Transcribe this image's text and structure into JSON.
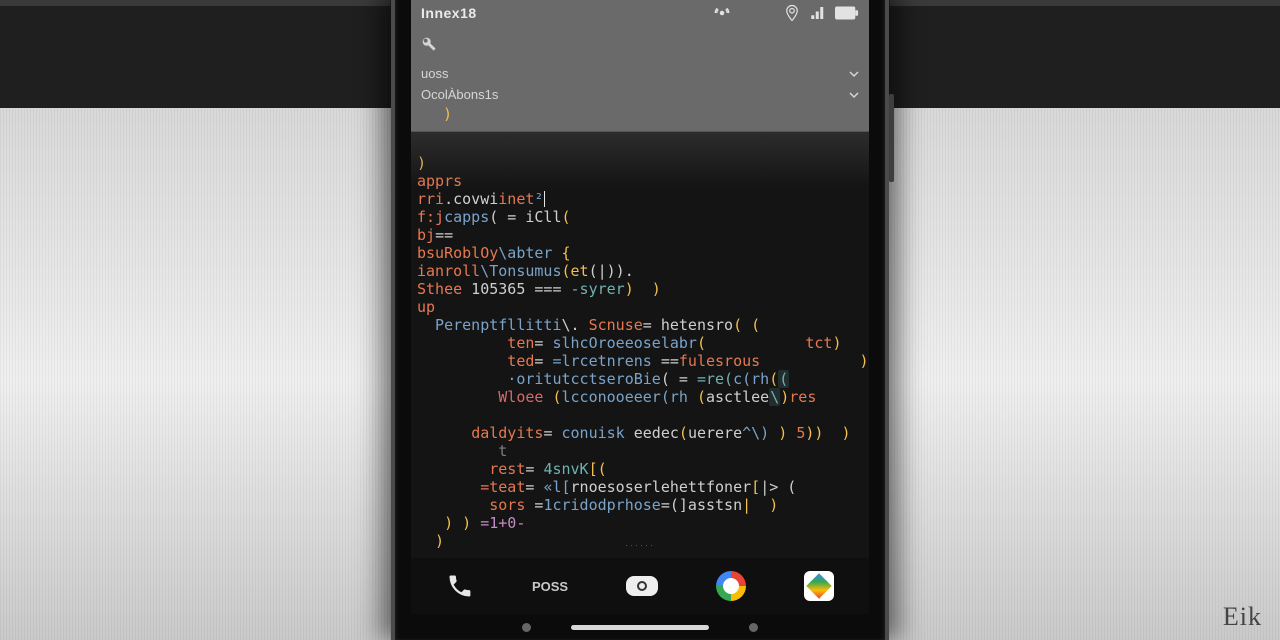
{
  "watermark": "Eik",
  "statusbar": {
    "carrier": "Innex18"
  },
  "notif": {
    "row1": "uoss",
    "row2": "OcolÀbons1s",
    "paren": ")"
  },
  "code": {
    "l1_paren": ")",
    "l2_apprs": "apprs",
    "l3_a": "rri",
    "l3_b": ".covwi",
    "l3_c": "inet",
    "l3_d": "²",
    "l3_caret": "|",
    "l4_a": "f:j",
    "l4_b": "capps",
    "l4_c": "( = ",
    "l4_d": "iCll",
    "l4_e": "(",
    "l5_a": "bj",
    "l5_b": "==",
    "l6_a": "bsuRoblOy",
    "l6_b": "\\abter",
    "l6_c": " {",
    "l7_a": "ianroll",
    "l7_b": "\\Tonsumus",
    "l7_c": "(et",
    "l7_d": "(|)).",
    "l8_a": "Sthee",
    "l8_b": " 105365 ",
    "l8_c": "=== ",
    "l8_d": "-syrer",
    "l8_e": ")  )",
    "l9_a": "up",
    "l10_a": "  Perenptfllitti",
    "l10_b": "\\. ",
    "l10_c": "Scnuse",
    "l10_d": "= ",
    "l10_e": "hetensro",
    "l10_f": "( ",
    "l10_g": "(",
    "l11_a": "          ten",
    "l11_b": "= ",
    "l11_c": "slhcOroeeoselabr",
    "l11_d": "(",
    "l11_e": "           ",
    "l11_f": "tct",
    "l11_g": ")    )",
    "l12_a": "          ted",
    "l12_b": "= ",
    "l12_c": "=lrcetnrens ",
    "l12_d": "==",
    "l12_e": "fulesrous",
    "l12_f": "           )",
    "l13_a": "          ",
    "l13_b": "·oritutcctseroBie",
    "l13_c": "( = ",
    "l13_d": "=re(",
    "l13_e": "c(rh",
    "l13_f": "(",
    "l13_g": "(",
    "l13_h": "         )",
    "l14_a": "         ",
    "l14_b": "Wloee",
    "l14_c": " (",
    "l14_d": "lcconooeeer(rh ",
    "l14_e": "(",
    "l14_f": "asctlee",
    "l14_g": "\\",
    "l14_h": ")",
    "l14_i": "res",
    "l14_j": "       )",
    "l15_blank": "",
    "l16_a": "      ",
    "l16_b": "daldyits",
    "l16_c": "= ",
    "l16_d": "conuisk ",
    "l16_e": "eedec",
    "l16_f": "(",
    "l16_g": "uerere",
    "l16_h": "^\\)",
    "l16_i": " ) ",
    "l16_j": "5",
    "l16_k": "))  )",
    "l17_a": "         t",
    "l18_a": "        rest",
    "l18_b": "= ",
    "l18_c": "4snvK",
    "l18_d": "[",
    "l18_e": "(",
    "l19_a": "       ",
    "l19_b": "=teat",
    "l19_c": "= ",
    "l19_d": "«l[",
    "l19_e": "rnoesoserlehettfoner",
    "l19_f": "[",
    "l19_g": "|> (",
    "l20_a": "        sors ",
    "l20_b": "=",
    "l20_c": "1cridodprhose",
    "l20_d": "=(",
    "l20_e": "]asstsn",
    "l20_f": "|  )",
    "l21_a": "   ) ",
    "l21_b": ") ",
    "l21_c": "=1+0-",
    "l22_a": "  )"
  },
  "dock": {
    "stamp": "······",
    "poss": "POSS"
  }
}
